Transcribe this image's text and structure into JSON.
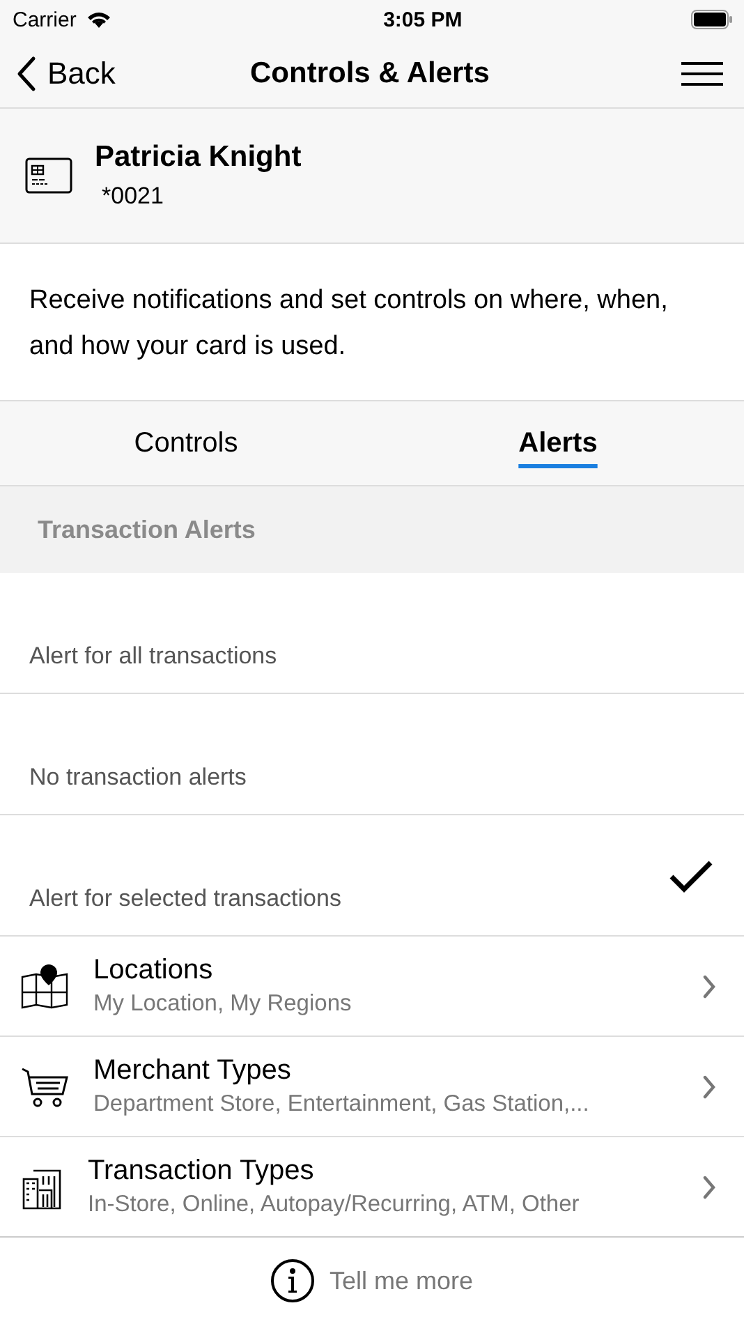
{
  "status_bar": {
    "carrier": "Carrier",
    "time": "3:05 PM"
  },
  "nav": {
    "back": "Back",
    "title": "Controls & Alerts"
  },
  "card": {
    "name": "Patricia Knight",
    "number": "*0021"
  },
  "description": "Receive notifications and set controls on where, when, and how your card is used.",
  "tabs": [
    {
      "label": "Controls",
      "selected": false
    },
    {
      "label": "Alerts",
      "selected": true
    }
  ],
  "section_header": "Transaction Alerts",
  "options": [
    {
      "label": "Alert for all transactions",
      "selected": false
    },
    {
      "label": "No transaction alerts",
      "selected": false
    },
    {
      "label": "Alert for selected transactions",
      "selected": true
    }
  ],
  "rows": [
    {
      "kind": "location",
      "title": "Locations",
      "subtitle": "My Location, My Regions"
    },
    {
      "kind": "merchant",
      "title": "Merchant Types",
      "subtitle": "Department Store, Entertainment, Gas Station,..."
    },
    {
      "kind": "transaction",
      "title": "Transaction Types",
      "subtitle": "In-Store, Online, Autopay/Recurring, ATM, Other"
    }
  ],
  "footer": {
    "label": "Tell me more"
  }
}
